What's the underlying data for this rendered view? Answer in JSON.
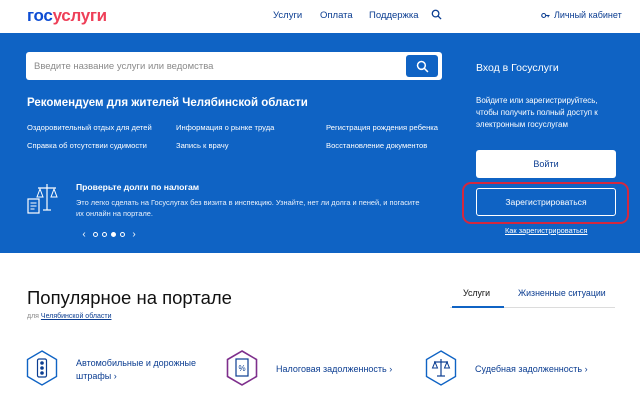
{
  "header": {
    "logo_part1": "гос",
    "logo_part2": "услуги",
    "nav": [
      "Услуги",
      "Оплата",
      "Поддержка"
    ],
    "cabinet_label": "Личный кабинет",
    "search_icon": "search-icon",
    "cabinet_icon": "key-icon"
  },
  "search": {
    "placeholder": "Введите название услуги или ведомства",
    "button_icon": "search-icon"
  },
  "recommend": {
    "title": "Рекомендуем для жителей Челябинской области",
    "links": [
      "Оздоровительный отдых для детей",
      "Информация о рынке труда",
      "Регистрация рождения ребенка",
      "Справка об отсутствии судимости",
      "Запись к врачу",
      "Восстановление документов"
    ]
  },
  "promo": {
    "icon": "scales-document-icon",
    "title": "Проверьте долги по налогам",
    "text": "Это легко сделать на Госуслугах без визита в инспекцию. Узнайте, нет ли долга и пеней, и погасите их онлайн на портале.",
    "prev": "‹",
    "next": "›",
    "slides_total": 4,
    "slide_active": 3
  },
  "login": {
    "title": "Вход в Госуслуги",
    "description": "Войдите или зарегистрируйтесь, чтобы получить полный доступ к электронным госуслугам",
    "login_button": "Войти",
    "register_button": "Зарегистрироваться",
    "how_register": "Как зарегистрироваться"
  },
  "popular": {
    "title": "Популярное на портале",
    "for_prefix": "для",
    "region": "Челябинской области",
    "tabs": [
      "Услуги",
      "Жизненные ситуации"
    ],
    "services": [
      {
        "line1": "Автомобильные и дорожные",
        "line2": "штрафы ›",
        "icon": "traffic-light-icon"
      },
      {
        "line1": "Налоговая задолженность ›",
        "line2": "",
        "icon": "tax-document-icon"
      },
      {
        "line1": "Судебная задолженность ›",
        "line2": "",
        "icon": "scales-icon"
      }
    ]
  },
  "colors": {
    "brand_blue": "#0f63c4",
    "logo_blue": "#0d4cd3",
    "logo_red": "#ee3f58",
    "highlight_red": "#d3283f",
    "icon_purple": "#7e2f8c"
  }
}
